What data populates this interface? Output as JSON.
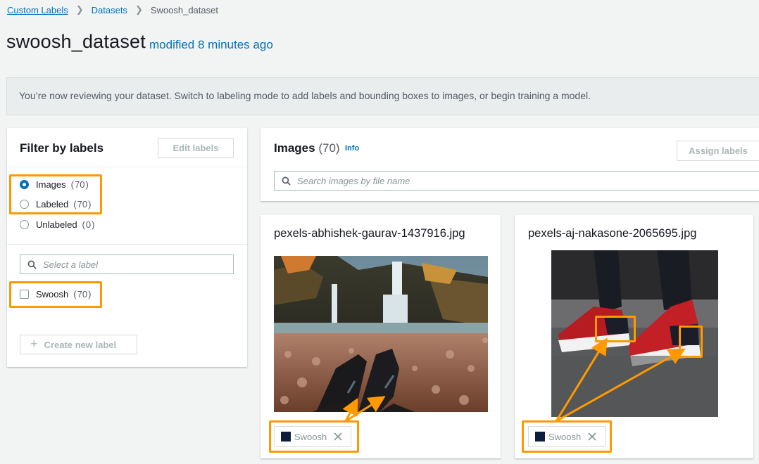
{
  "breadcrumb": {
    "items": [
      "Custom Labels",
      "Datasets"
    ],
    "current": "Swoosh_dataset"
  },
  "header": {
    "title": "swoosh_dataset",
    "modified": "modified 8 minutes ago"
  },
  "banner": {
    "text": "You’re now reviewing your dataset. Switch to labeling mode to add labels and bounding boxes to images, or begin training a model."
  },
  "filter": {
    "title": "Filter by labels",
    "edit_button": "Edit labels",
    "options": [
      {
        "label": "Images",
        "count": "70",
        "checked": true
      },
      {
        "label": "Labeled",
        "count": "70",
        "checked": false
      },
      {
        "label": "Unlabeled",
        "count": "0",
        "checked": false
      }
    ],
    "label_search_placeholder": "Select a label",
    "labels": [
      {
        "label": "Swoosh",
        "count": "70"
      }
    ],
    "create_button": "Create new label"
  },
  "images": {
    "title": "Images",
    "count": "(70)",
    "info_link": "Info",
    "assign_button": "Assign labels",
    "search_placeholder": "Search images by file name",
    "cards": [
      {
        "file_name": "pexels-abhishek-gaurav-1437916.jpg",
        "tag": "Swoosh"
      },
      {
        "file_name": "pexels-aj-nakasone-2065695.jpg",
        "tag": "Swoosh"
      }
    ]
  },
  "colors": {
    "accent": "#0073bb",
    "highlight": "#ff9900",
    "label_swatch": "#0d1e3d"
  }
}
